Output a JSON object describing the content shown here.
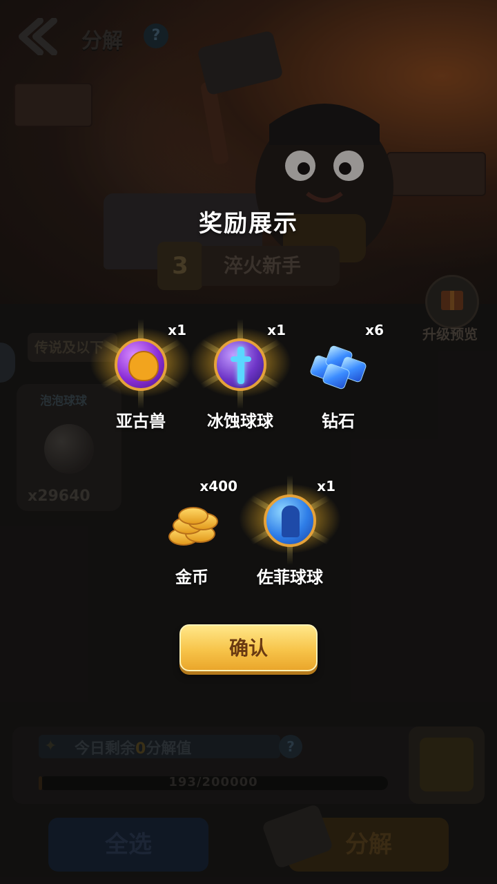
{
  "header": {
    "title": "分解",
    "help_glyph": "?"
  },
  "rank": {
    "level": "3",
    "title": "淬火新手"
  },
  "upgrade_preview": {
    "label": "升级预览"
  },
  "filter": {
    "label": "传说及以下"
  },
  "inventory_card": {
    "name": "泡泡球球",
    "count": "x29640"
  },
  "daily": {
    "remaining_label_prefix": "今日剩余",
    "remaining_value": "0",
    "remaining_label_suffix": "分解值",
    "help_glyph": "?",
    "progress_text": "193/200000",
    "progress_fraction": 0.001
  },
  "buttons": {
    "select_all": "全选",
    "decompose": "分解"
  },
  "reward_modal": {
    "title": "奖励展示",
    "rewards": [
      {
        "name": "亚古兽",
        "qty": "x1",
        "icon": "agumon-ball-icon"
      },
      {
        "name": "冰蚀球球",
        "qty": "x1",
        "icon": "ice-sword-ball-icon"
      },
      {
        "name": "钻石",
        "qty": "x6",
        "icon": "diamond-icon"
      },
      {
        "name": "金币",
        "qty": "x400",
        "icon": "gold-coin-icon"
      },
      {
        "name": "佐菲球球",
        "qty": "x1",
        "icon": "zoffy-ball-icon"
      }
    ],
    "confirm_label": "确认"
  },
  "colors": {
    "confirm_button": "#f7c44a",
    "glow": "#ffd640",
    "overlay": "#000000"
  }
}
